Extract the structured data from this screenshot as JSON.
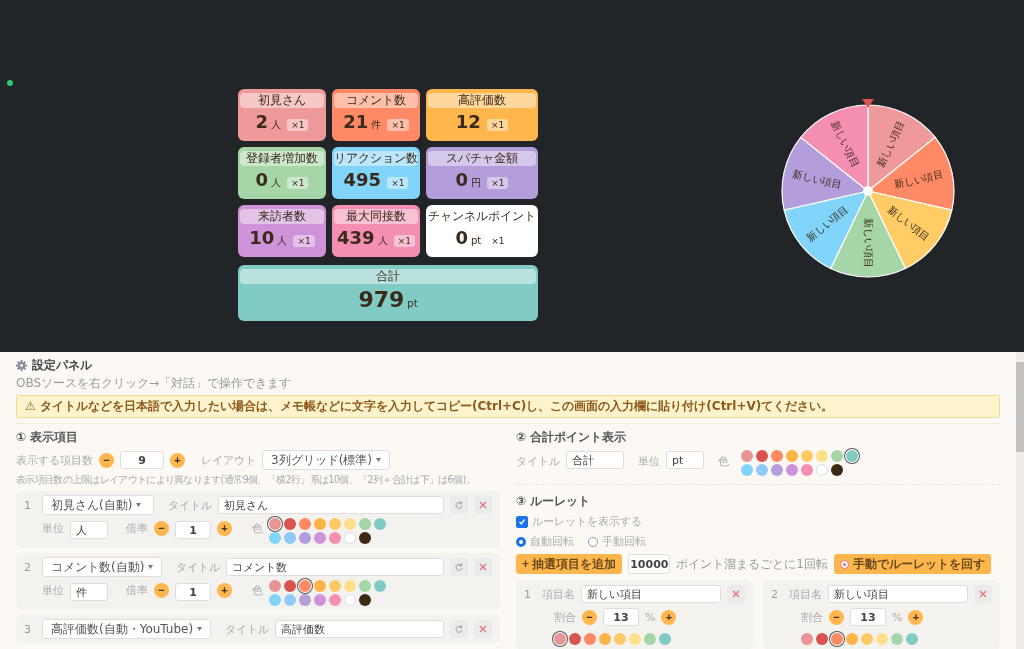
{
  "overlay": {
    "cards": [
      {
        "title": "初見さん",
        "value": "2",
        "unit": "人",
        "multiplier": "×1",
        "color": "#ef9a9a"
      },
      {
        "title": "コメント数",
        "value": "21",
        "unit": "件",
        "multiplier": "×1",
        "color": "#ff8a65"
      },
      {
        "title": "高評価数",
        "value": "12",
        "multiplier": "×1",
        "color": "#ffb74d"
      },
      {
        "title": "登録者増加数",
        "value": "0",
        "unit": "人",
        "multiplier": "×1",
        "color": "#a5d6a7"
      },
      {
        "title": "リアクション数",
        "value": "495",
        "multiplier": "×1",
        "color": "#81d4fa"
      },
      {
        "title": "スパチャ金額",
        "value": "0",
        "unit": "円",
        "multiplier": "×1",
        "color": "#b39ddb"
      },
      {
        "title": "来訪者数",
        "value": "10",
        "unit": "人",
        "multiplier": "×1",
        "color": "#ce93d8"
      },
      {
        "title": "最大同接数",
        "value": "439",
        "unit": "人",
        "multiplier": "×1",
        "color": "#f48fb1"
      },
      {
        "title": "チャンネルポイント",
        "value": "0",
        "unit": "pt",
        "multiplier": "×1",
        "color": "#ffffff"
      }
    ],
    "total": {
      "title": "合計",
      "value": "979",
      "unit": "pt",
      "color": "#80cbc4"
    },
    "wheel": [
      {
        "label": "新しい項目",
        "color": "#ef9a9a"
      },
      {
        "label": "新しい項目",
        "color": "#ff8a65"
      },
      {
        "label": "新しい項目",
        "color": "#ffcc66"
      },
      {
        "label": "新しい項目",
        "color": "#a5d6a7"
      },
      {
        "label": "新しい項目",
        "color": "#81d4fa"
      },
      {
        "label": "新しい項目",
        "color": "#b39ddb"
      },
      {
        "label": "新しい項目",
        "color": "#f48fb1"
      }
    ]
  },
  "settings": {
    "title": "設定パネル",
    "subtitle": "OBSソースを右クリック→「対話」で操作できます",
    "warning": "⚠ タイトルなどを日本語で入力したい場合は、メモ帳などに文字を入力してコピー(Ctrl+C)し、この画面の入力欄に貼り付け(Ctrl+V)てください。",
    "display_items": {
      "heading": "① 表示項目",
      "count_label": "表示する項目数",
      "minus": "−",
      "count": "9",
      "plus": "+",
      "layout_label": "レイアウト",
      "layout": "3列グリッド(標準)",
      "note": "表示項目数の上限はレイアウトにより異なります(通常9個、「横2行」系は10個、「2列＋合計は下」は6個)。",
      "items": [
        {
          "number": "1",
          "source": "初見さん(自動)",
          "title_label": "タイトル",
          "title": "初見さん",
          "unit_label": "単位",
          "unit": "人",
          "rate_label": "倍率",
          "minus": "−",
          "rate": "1",
          "plus": "+",
          "color_label": "色",
          "swatches": [
            {
              "color": "#e89595",
              "selected": true
            },
            {
              "color": "#d9534f",
              "selected": false
            },
            {
              "color": "#ff8a65",
              "selected": false
            },
            {
              "color": "#ffb347",
              "selected": false
            },
            {
              "color": "#ffc966",
              "selected": false
            },
            {
              "color": "#ffe08a",
              "selected": false
            },
            {
              "color": "#a5d6a7",
              "selected": false
            },
            {
              "color": "#80cbc4",
              "selected": false
            },
            {
              "color": "#81d4fa",
              "selected": false
            },
            {
              "color": "#90caf9",
              "selected": false
            },
            {
              "color": "#b39ddb",
              "selected": false
            },
            {
              "color": "#ce93d8",
              "selected": false
            },
            {
              "color": "#f48fb1",
              "selected": false
            },
            {
              "color": "#ffffff",
              "selected": false
            },
            {
              "color": "#3e2a14",
              "selected": false
            }
          ]
        },
        {
          "number": "2",
          "source": "コメント数(自動)",
          "title_label": "タイトル",
          "title": "コメント数",
          "unit_label": "単位",
          "unit": "件",
          "rate_label": "倍率",
          "minus": "−",
          "rate": "1",
          "plus": "+",
          "color_label": "色",
          "swatches": [
            {
              "color": "#e89595",
              "selected": false
            },
            {
              "color": "#d9534f",
              "selected": false
            },
            {
              "color": "#ff8a65",
              "selected": true
            },
            {
              "color": "#ffb347",
              "selected": false
            },
            {
              "color": "#ffc966",
              "selected": false
            },
            {
              "color": "#ffe08a",
              "selected": false
            },
            {
              "color": "#a5d6a7",
              "selected": false
            },
            {
              "color": "#80cbc4",
              "selected": false
            },
            {
              "color": "#81d4fa",
              "selected": false
            },
            {
              "color": "#90caf9",
              "selected": false
            },
            {
              "color": "#b39ddb",
              "selected": false
            },
            {
              "color": "#ce93d8",
              "selected": false
            },
            {
              "color": "#f48fb1",
              "selected": false
            },
            {
              "color": "#ffffff",
              "selected": false
            },
            {
              "color": "#3e2a14",
              "selected": false
            }
          ]
        },
        {
          "number": "3",
          "source": "高評価数(自動・YouTube)",
          "title_label": "タイトル",
          "title": "高評価数"
        }
      ]
    },
    "total_display": {
      "heading": "② 合計ポイント表示",
      "title_label": "タイトル",
      "title": "合計",
      "unit_label": "単位",
      "unit": "pt",
      "color_label": "色",
      "swatches": [
        {
          "color": "#e89595",
          "selected": false
        },
        {
          "color": "#d9534f",
          "selected": false
        },
        {
          "color": "#ff8a65",
          "selected": false
        },
        {
          "color": "#ffb347",
          "selected": false
        },
        {
          "color": "#ffc966",
          "selected": false
        },
        {
          "color": "#ffe08a",
          "selected": false
        },
        {
          "color": "#a5d6a7",
          "selected": false
        },
        {
          "color": "#80cbc4",
          "selected": true
        },
        {
          "color": "#81d4fa",
          "selected": false
        },
        {
          "color": "#90caf9",
          "selected": false
        },
        {
          "color": "#b39ddb",
          "selected": false
        },
        {
          "color": "#ce93d8",
          "selected": false
        },
        {
          "color": "#f48fb1",
          "selected": false
        },
        {
          "color": "#ffffff",
          "selected": false
        },
        {
          "color": "#3e2a14",
          "selected": false
        }
      ]
    },
    "roulette": {
      "heading": "③ ルーレット",
      "show": {
        "label": "ルーレットを表示する",
        "checked": true
      },
      "modes": [
        {
          "label": "自動回転",
          "selected": true
        },
        {
          "label": "手動回転",
          "selected": false
        }
      ],
      "add_button": "+ 抽選項目を追加",
      "points": "10000",
      "points_note": "ポイント溜まるごとに1回転",
      "spin_button": "手動でルーレットを回す",
      "items": [
        {
          "number": "1",
          "name_label": "項目名",
          "name": "新しい項目",
          "ratio_label": "割合",
          "minus": "−",
          "ratio": "13",
          "percent": "%",
          "plus": "+",
          "swatches": [
            {
              "color": "#e89595",
              "selected": true
            },
            {
              "color": "#d9534f",
              "selected": false
            },
            {
              "color": "#ff8a65",
              "selected": false
            },
            {
              "color": "#ffb347",
              "selected": false
            },
            {
              "color": "#ffc966",
              "selected": false
            },
            {
              "color": "#ffe08a",
              "selected": false
            },
            {
              "color": "#a5d6a7",
              "selected": false
            },
            {
              "color": "#80cbc4",
              "selected": false
            }
          ]
        },
        {
          "number": "2",
          "name_label": "項目名",
          "name": "新しい項目",
          "ratio_label": "割合",
          "minus": "−",
          "ratio": "13",
          "percent": "%",
          "plus": "+",
          "swatches": [
            {
              "color": "#e89595",
              "selected": false
            },
            {
              "color": "#d9534f",
              "selected": false
            },
            {
              "color": "#ff8a65",
              "selected": true
            },
            {
              "color": "#ffb347",
              "selected": false
            },
            {
              "color": "#ffc966",
              "selected": false
            },
            {
              "color": "#ffe08a",
              "selected": false
            },
            {
              "color": "#a5d6a7",
              "selected": false
            },
            {
              "color": "#80cbc4",
              "selected": false
            }
          ]
        }
      ]
    }
  }
}
